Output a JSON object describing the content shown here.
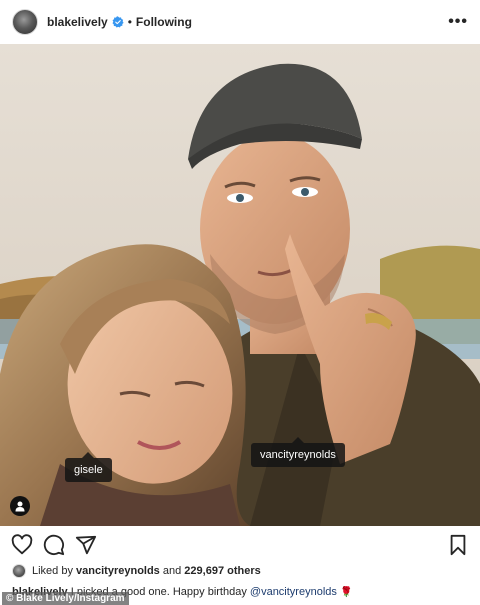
{
  "header": {
    "username": "blakelively",
    "separator": "•",
    "follow_status": "Following",
    "more_glyph": "•••"
  },
  "post": {
    "tags": [
      {
        "label": "gisele"
      },
      {
        "label": "vancityreynolds"
      }
    ]
  },
  "likes": {
    "prefix": "Liked by",
    "user": "vancityreynolds",
    "middle": "and",
    "count": "229,697 others"
  },
  "caption": {
    "username": "blakelively",
    "text": "I picked a good one. Happy birthday",
    "mention": "@vancityreynolds",
    "emoji": "🌹"
  },
  "credit": "© Blake Lively/Instagram",
  "icons": {
    "header": [
      "avatar",
      "verified-badge-icon",
      "more-options-icon"
    ],
    "actions": [
      "heart-icon",
      "comment-icon",
      "share-icon",
      "bookmark-icon"
    ],
    "photo": [
      "user-tag-icon"
    ]
  },
  "colors": {
    "verified": "#3897f0",
    "text": "#262626",
    "mention": "#1d3c6e",
    "tag_bg": "#141414"
  }
}
